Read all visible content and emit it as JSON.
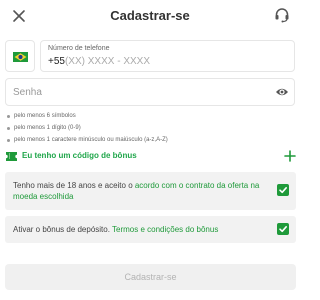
{
  "header": {
    "title": "Cadastrar-se",
    "close_icon": "close-icon",
    "support_icon": "headset-support-icon"
  },
  "phone": {
    "country_flag": "brazil-flag",
    "label": "Número de telefone",
    "prefix": "+55",
    "placeholder": "(XX) XXXX - XXXX"
  },
  "password": {
    "placeholder": "Senha",
    "toggle_icon": "eye-icon"
  },
  "password_rules": [
    "pelo menos 6 símbolos",
    "pelo menos 1 dígito (0-9)",
    "pelo menos 1 caractere minúsculo ou maiúsculo (a-z,A-Z)"
  ],
  "bonus": {
    "label": "Eu tenho um código de bônus",
    "icon": "ticket-icon",
    "add_icon": "plus-icon"
  },
  "consents": {
    "age": {
      "text_prefix": "Tenho mais de 18 anos e aceito o ",
      "link_text": "acordo com o contrato da oferta na moeda escolhida",
      "checked": true
    },
    "deposit_bonus": {
      "text_prefix": "Ativar o bônus de depósito. ",
      "link_text": "Termos e condições do bônus",
      "checked": true
    }
  },
  "submit": {
    "label": "Cadastrar-se",
    "enabled": false
  },
  "colors": {
    "accent_green": "#1f9a3a",
    "bonus_green": "#1fa64a",
    "field_border": "#e6e6e6",
    "consent_bg": "#f2f2f2",
    "disabled_button_bg": "#f0f0f0"
  }
}
